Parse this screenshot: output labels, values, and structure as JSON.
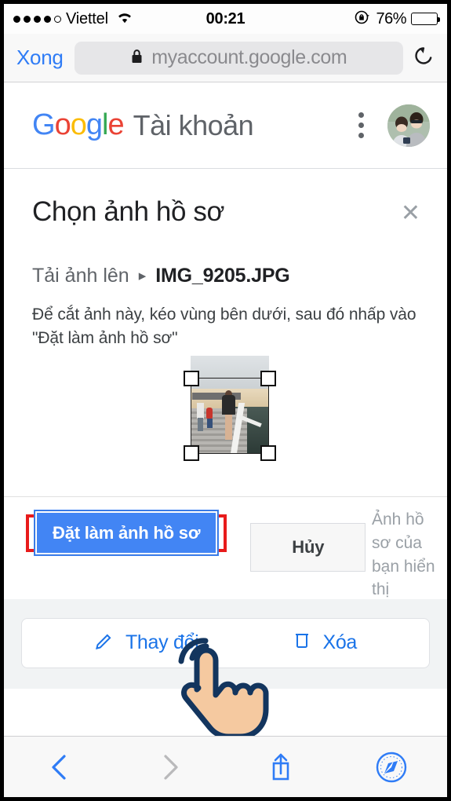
{
  "status_bar": {
    "signal_dots_filled": 4,
    "signal_dots_total": 5,
    "carrier": "Viettel",
    "wifi_icon": "wifi-icon",
    "time": "00:21",
    "rotation_lock_icon": "rotation-lock-icon",
    "battery_percent": "76%",
    "battery_level": 76
  },
  "browser": {
    "done_label": "Xong",
    "lock_icon": "lock-icon",
    "url": "myaccount.google.com",
    "reload_icon": "reload-icon",
    "toolbar": {
      "back_icon": "chevron-left-icon",
      "forward_icon": "chevron-right-icon",
      "share_icon": "share-icon",
      "bookmarks_icon": "safari-compass-icon"
    }
  },
  "google_header": {
    "logo_letters": [
      {
        "char": "G",
        "color": "#4285F4"
      },
      {
        "char": "o",
        "color": "#EA4335"
      },
      {
        "char": "o",
        "color": "#FBBC05"
      },
      {
        "char": "g",
        "color": "#4285F4"
      },
      {
        "char": "l",
        "color": "#34A853"
      },
      {
        "char": "e",
        "color": "#EA4335"
      }
    ],
    "product_name": "Tài khoản",
    "menu_icon": "kebab-menu-icon",
    "avatar_icon": "account-avatar"
  },
  "dialog": {
    "title": "Chọn ảnh hồ sơ",
    "close_icon": "close-icon",
    "breadcrumb": {
      "source": "Tải ảnh lên",
      "separator": "▸",
      "filename": "IMG_9205.JPG"
    },
    "instructions": "Để cắt ảnh này, kéo vùng bên dưới, sau đó nhấp vào \"Đặt làm ảnh hồ sơ\"",
    "crop": {
      "image_name": "crop-preview-photo",
      "handles": [
        "top-left",
        "top-right",
        "bottom-left",
        "bottom-right"
      ]
    },
    "primary_button": "Đặt làm ảnh hồ sơ",
    "cancel_button": "Hủy",
    "side_note": "Ảnh hồ sơ của bạn hiển thị"
  },
  "action_card": {
    "change": {
      "icon": "pencil-icon",
      "label": "Thay đổi"
    },
    "delete": {
      "icon": "trash-icon",
      "label": "Xóa"
    }
  },
  "annotation": {
    "highlight_color": "#e81b1b",
    "cursor_icon": "tap-hand-cursor"
  },
  "colors": {
    "primary_blue": "#4285F4",
    "link_blue": "#1a73e8",
    "ios_blue": "#2f7cf6",
    "text_dark": "#202124",
    "text_grey": "#5f6368",
    "page_bg": "#f1f3f4"
  }
}
